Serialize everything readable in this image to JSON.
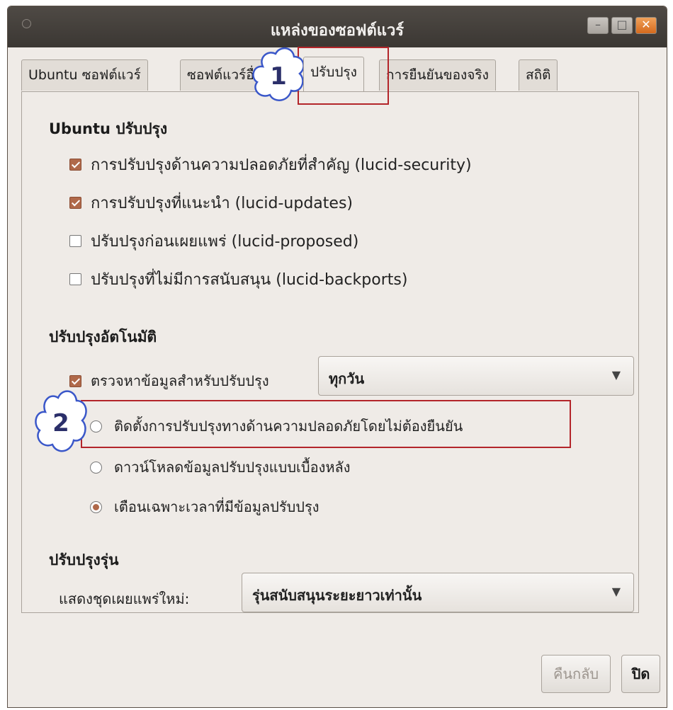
{
  "window": {
    "title": "แหล่งของซอฟต์แวร์",
    "controls": {
      "minimize": "–",
      "maximize": "□",
      "close": "✕"
    }
  },
  "tabs": [
    {
      "label": "Ubuntu ซอฟต์แวร์"
    },
    {
      "label": "ซอฟต์แวร์อื่น"
    },
    {
      "label": "ปรับปรุง",
      "active": true
    },
    {
      "label": "การยืนยันของจริง"
    },
    {
      "label": "สถิติ"
    }
  ],
  "ubuntu_updates": {
    "title": "Ubuntu ปรับปรุง",
    "items": [
      {
        "label": "การปรับปรุงด้านความปลอดภัยที่สำคัญ (lucid-security)",
        "checked": true
      },
      {
        "label": "การปรับปรุงที่แนะนำ (lucid-updates)",
        "checked": true
      },
      {
        "label": "ปรับปรุงก่อนเผยแพร่ (lucid-proposed)",
        "checked": false
      },
      {
        "label": "ปรับปรุงที่ไม่มีการสนับสนุน (lucid-backports)",
        "checked": false
      }
    ]
  },
  "auto_updates": {
    "title": "ปรับปรุงอัตโนมัติ",
    "check_label": "ตรวจหาข้อมูลสำหรับปรับปรุง",
    "check_checked": true,
    "frequency": "ทุกวัน",
    "options": [
      {
        "label": "ติดตั้งการปรับปรุงทางด้านความปลอดภัยโดยไม่ต้องยืนยัน",
        "selected": false
      },
      {
        "label": "ดาวน์โหลดข้อมูลปรับปรุงแบบเบื้องหลัง",
        "selected": false
      },
      {
        "label": "เตือนเฉพาะเวลาที่มีข้อมูลปรับปรุง",
        "selected": true
      }
    ]
  },
  "release_upgrade": {
    "title": "ปรับปรุงรุ่น",
    "label": "แสดงชุดเผยแพร่ใหม่:",
    "value": "รุ่นสนับสนุนระยะยาวเท่านั้น"
  },
  "buttons": {
    "revert": "คืนกลับ",
    "close": "ปิด"
  },
  "annotations": {
    "marker_1": "1",
    "marker_2": "2",
    "color": "#b3252a",
    "cloud_color": "#3a57c9"
  }
}
